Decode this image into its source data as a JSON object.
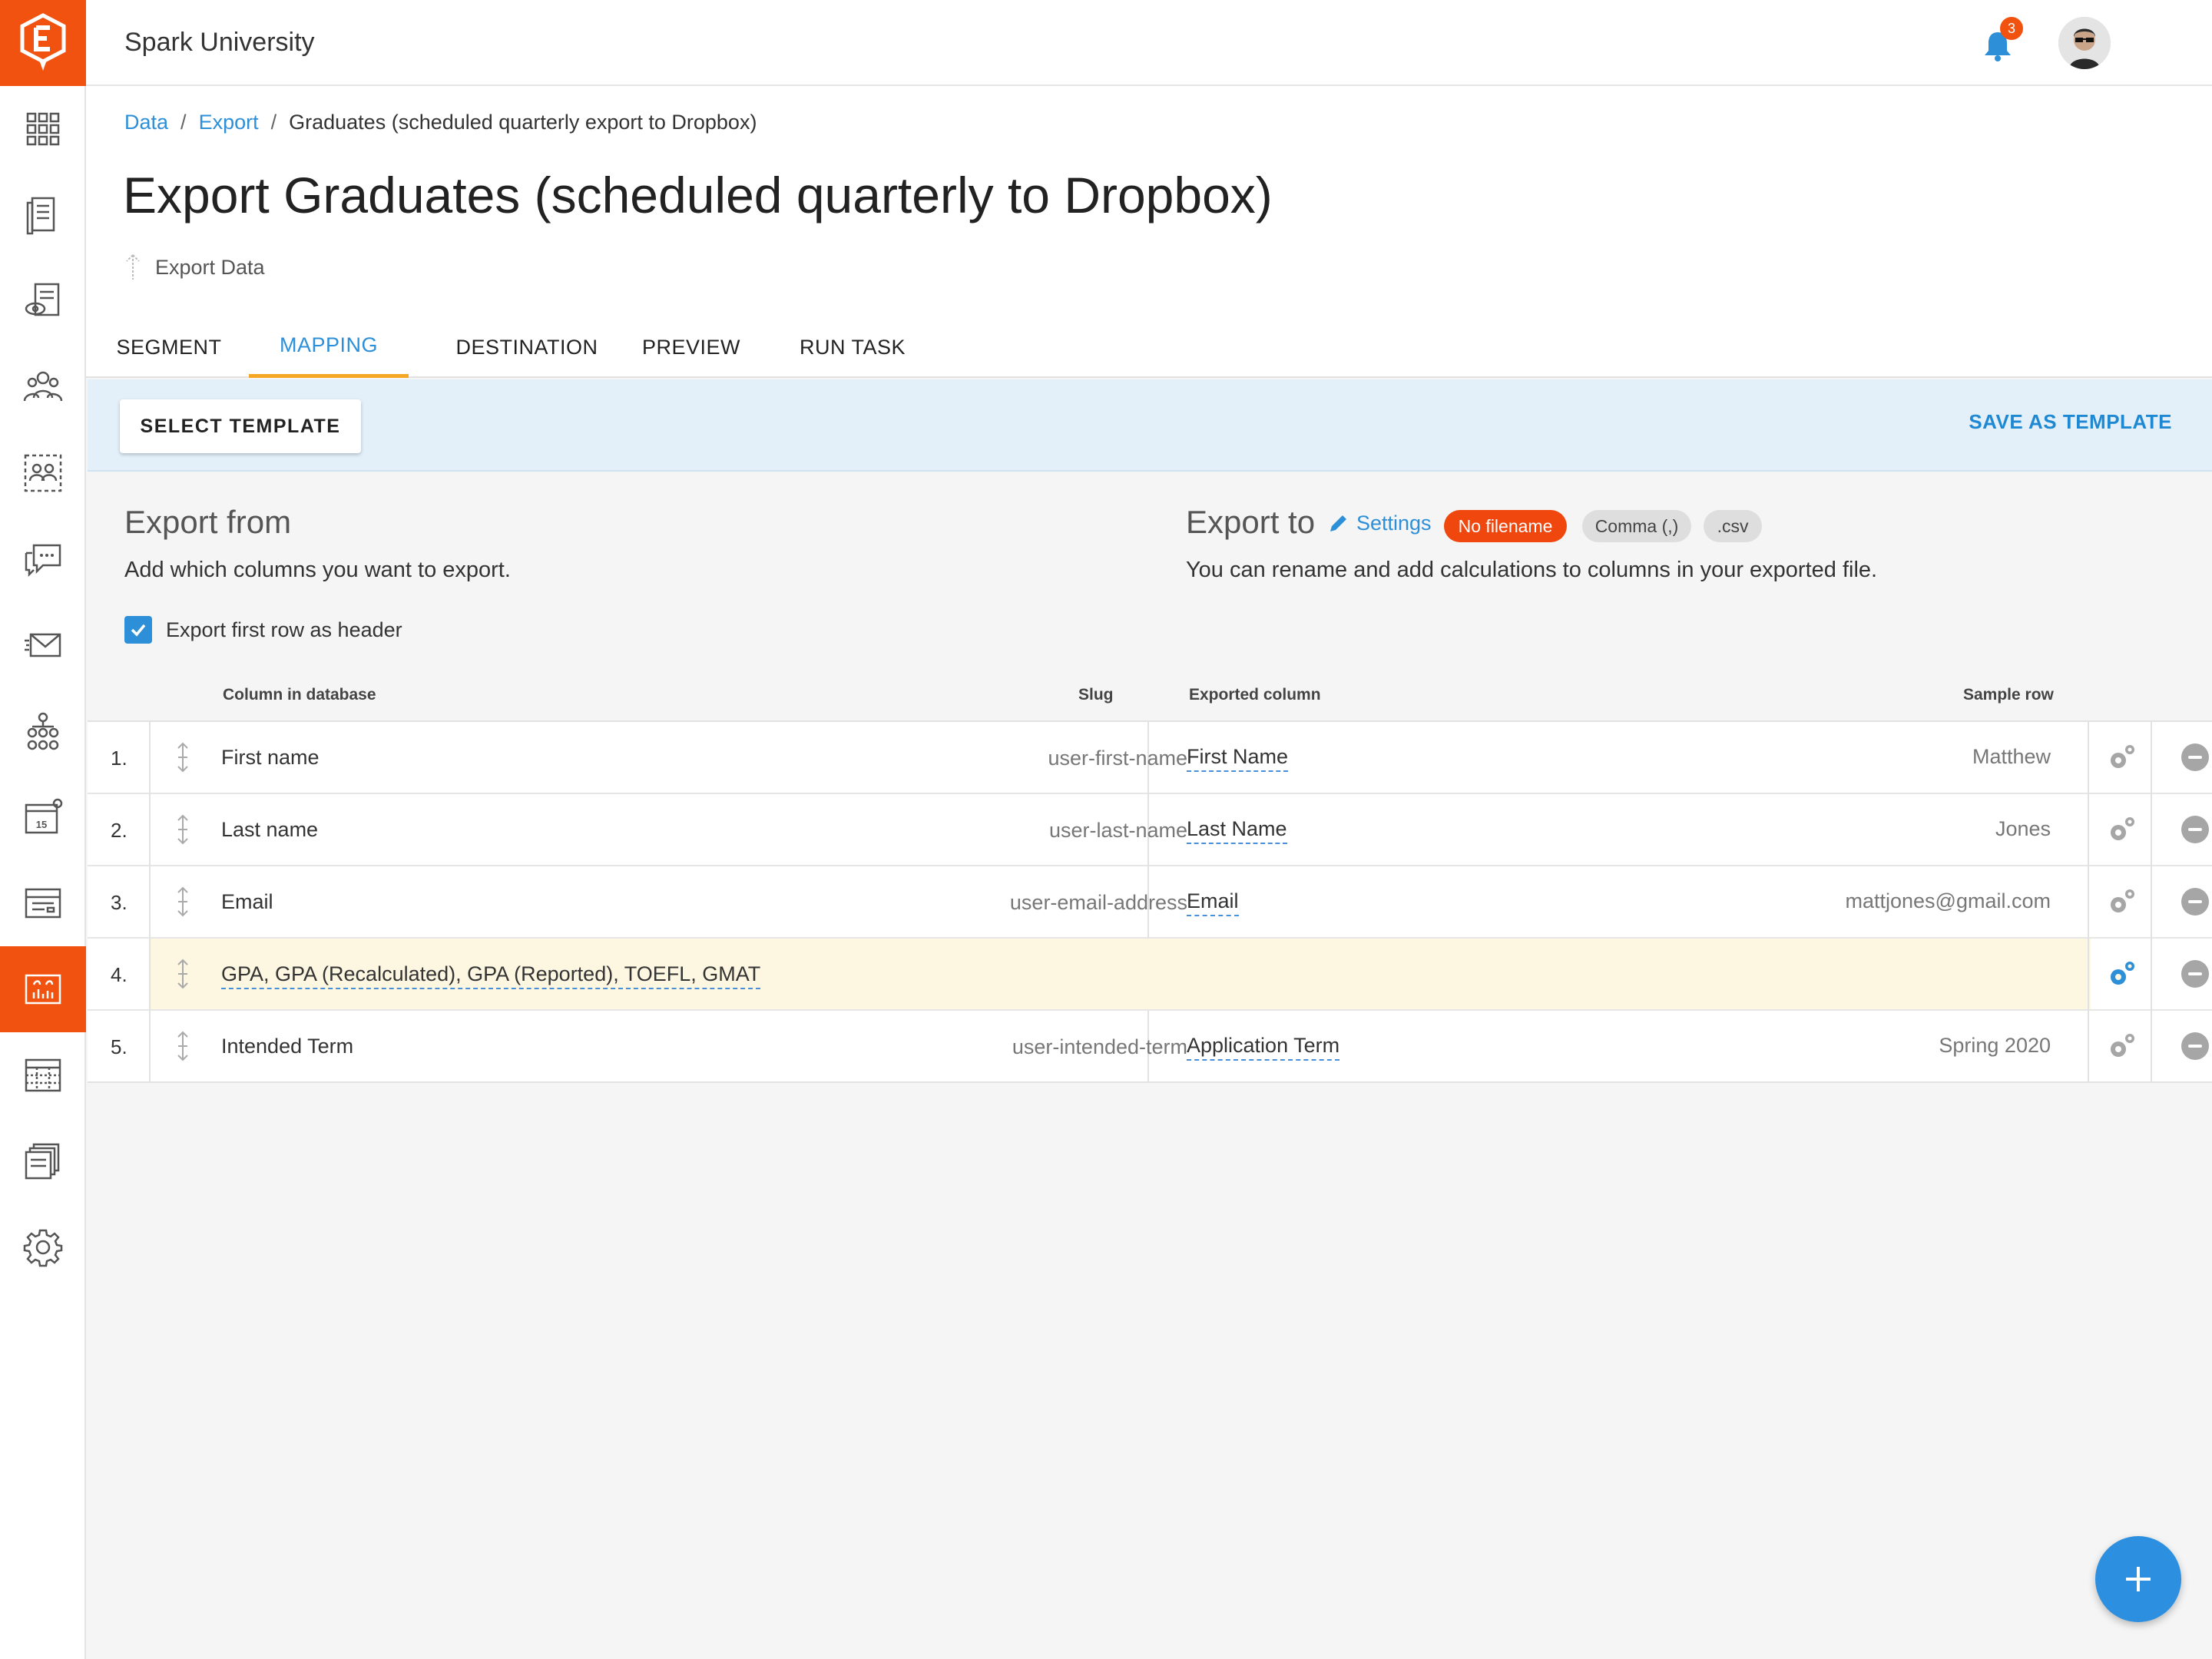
{
  "header": {
    "org_name": "Spark University",
    "notifications_count": "3"
  },
  "sidebar": {
    "items": [
      {
        "icon": "dashboard-grid-icon"
      },
      {
        "icon": "forms-icon"
      },
      {
        "icon": "reviews-icon"
      },
      {
        "icon": "people-icon"
      },
      {
        "icon": "groups-icon"
      },
      {
        "icon": "messages-icon"
      },
      {
        "icon": "email-icon"
      },
      {
        "icon": "workflows-icon"
      },
      {
        "icon": "calendar-icon",
        "label": "15"
      },
      {
        "icon": "pages-icon"
      },
      {
        "icon": "data-icon",
        "active": true
      },
      {
        "icon": "reports-icon"
      },
      {
        "icon": "documents-icon"
      },
      {
        "icon": "settings-icon"
      }
    ]
  },
  "breadcrumb": {
    "items": [
      "Data",
      "Export"
    ],
    "current": "Graduates (scheduled quarterly export to Dropbox)",
    "separator": "/"
  },
  "page": {
    "title": "Export Graduates (scheduled quarterly to Dropbox)",
    "subtitle": "Export Data"
  },
  "tabs": [
    {
      "label": "SEGMENT"
    },
    {
      "label": "MAPPING",
      "active": true
    },
    {
      "label": "DESTINATION"
    },
    {
      "label": "PREVIEW"
    },
    {
      "label": "RUN TASK"
    }
  ],
  "toolbar": {
    "select_template_label": "SELECT TEMPLATE",
    "save_template_label": "SAVE AS TEMPLATE"
  },
  "export_from": {
    "heading": "Export from",
    "description": "Add which columns you want to export.",
    "header_checkbox_label": "Export first row as header",
    "header_checkbox_checked": true
  },
  "export_to": {
    "heading": "Export to",
    "settings_label": "Settings",
    "description": "You can rename and add calculations to columns in your exported file.",
    "pills": [
      "No filename",
      "Comma (,)",
      ".csv"
    ]
  },
  "table": {
    "headers": {
      "column_in_database": "Column in database",
      "slug": "Slug",
      "exported_column": "Exported column",
      "sample_row": "Sample row"
    },
    "rows": [
      {
        "index": "1.",
        "column": "First name",
        "slug": "user-first-name",
        "exported": "First Name",
        "sample": "Matthew"
      },
      {
        "index": "2.",
        "column": "Last name",
        "slug": "user-last-name",
        "exported": "Last Name",
        "sample": "Jones"
      },
      {
        "index": "3.",
        "column": "Email",
        "slug": "user-email-address",
        "exported": "Email",
        "sample": "mattjones@gmail.com"
      },
      {
        "index": "4.",
        "column": "GPA, GPA (Recalculated), GPA (Reported), TOEFL, GMAT",
        "highlighted": true
      },
      {
        "index": "5.",
        "column": "Intended Term",
        "slug": "user-intended-term",
        "exported": "Application Term",
        "sample": "Spring 2020"
      }
    ]
  },
  "colors": {
    "brand_orange": "#f2520f",
    "link_blue": "#2d8fd8",
    "tab_underline": "#f5a623",
    "template_bar": "#e3f0fa",
    "highlight_row": "#fdf6e1"
  }
}
